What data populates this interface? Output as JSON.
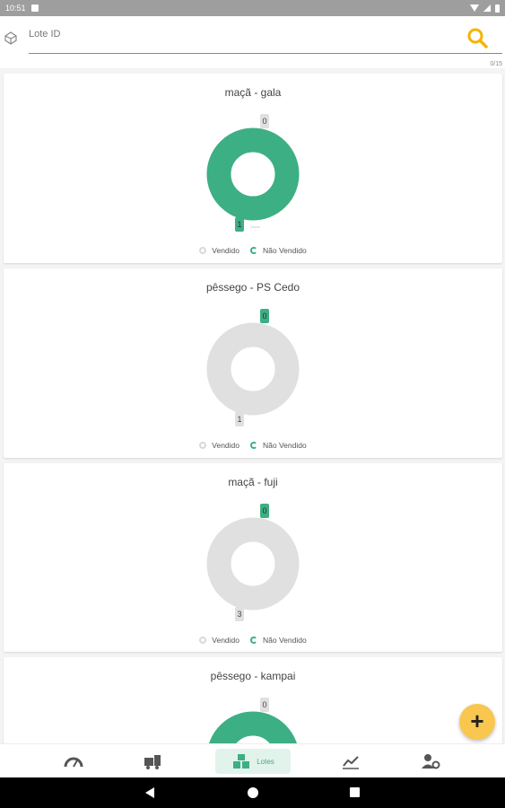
{
  "status_bar": {
    "time": "10:51"
  },
  "search": {
    "placeholder": "Lote ID",
    "counter": "0/15"
  },
  "colors": {
    "accent": "#3daf84",
    "unsold_grey": "#e0e0e0",
    "fab": "#f9c74f"
  },
  "legend": {
    "sold": "Vendido",
    "unsold": "Não Vendido"
  },
  "lots": [
    {
      "title": "maçã - gala",
      "sold": 0,
      "unsold": 1
    },
    {
      "title": "pêssego - PS Cedo",
      "sold": 0,
      "unsold": 1
    },
    {
      "title": "maçã - fuji",
      "sold": 0,
      "unsold": 3
    },
    {
      "title": "pêssego - kampai",
      "sold": 0,
      "unsold": null
    }
  ],
  "bottom_nav": {
    "items": [
      {
        "icon": "dashboard-icon"
      },
      {
        "icon": "truck-icon"
      },
      {
        "icon": "lots-icon",
        "label": "Lotes",
        "active": true
      },
      {
        "icon": "chart-trend-icon"
      },
      {
        "icon": "user-settings-icon"
      }
    ]
  },
  "fab": {
    "label": "+"
  }
}
